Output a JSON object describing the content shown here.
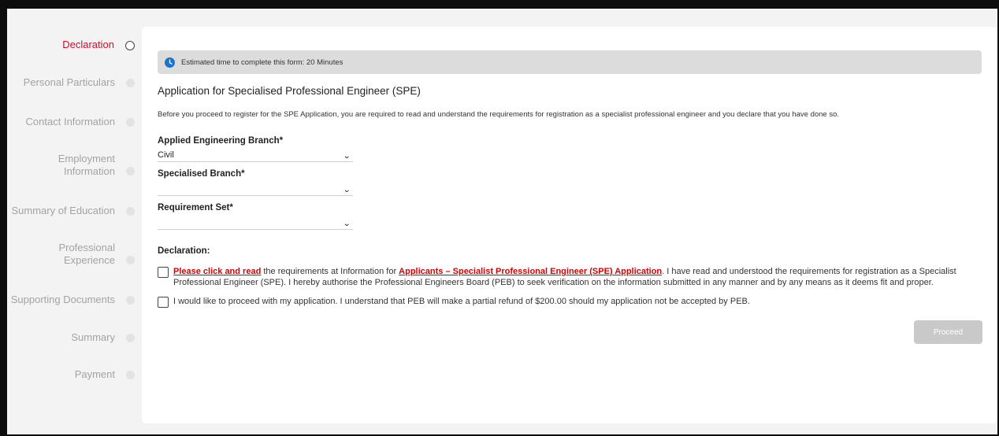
{
  "sidebar": {
    "steps": [
      {
        "label": "Declaration",
        "active": true
      },
      {
        "label": "Personal Particulars"
      },
      {
        "label": "Contact Information"
      },
      {
        "label_line1": "Employment",
        "label_line2": "Information"
      },
      {
        "label": "Summary of Education"
      },
      {
        "label_line1": "Professional",
        "label_line2": "Experience"
      },
      {
        "label": "Supporting Documents"
      },
      {
        "label": "Summary"
      },
      {
        "label": "Payment"
      }
    ]
  },
  "banner": {
    "icon": "clock-icon",
    "text": "Estimated time to complete this form: 20 Minutes"
  },
  "form": {
    "title": "Application for Specialised Professional Engineer (SPE)",
    "intro": "Before you proceed to register for the SPE Application, you are required to read and understand the requirements for registration as a specialist professional engineer and you declare that you have done so.",
    "engineering_branch": {
      "label": "Applied Engineering Branch*",
      "value": "Civil"
    },
    "specialised_branch": {
      "label": "Specialised Branch*",
      "value": ""
    },
    "requirement_set": {
      "label": "Requirement Set*",
      "value": ""
    },
    "declaration": {
      "title": "Declaration:",
      "item1": {
        "link1": "Please click and read",
        "text1": " the requirements at Information for ",
        "link2": "Applicants – Specialist Professional Engineer (SPE) Application",
        "text2": ". I have read and understood the requirements for registration as a Specialist Professional Engineer (SPE). I hereby authorise the Professional Engineers Board (PEB) to seek verification on the information submitted in any manner and by any means as it deems fit and proper."
      },
      "item2": "I would like to proceed with my application. I understand that PEB will make a partial refund of $200.00 should my application not be accepted by PEB."
    },
    "proceed_label": "Proceed"
  },
  "colors": {
    "accent_red": "#c8102e",
    "link_red": "#d60000",
    "clock_blue": "#1a73c9",
    "disabled_button": "#c9c9c9"
  }
}
